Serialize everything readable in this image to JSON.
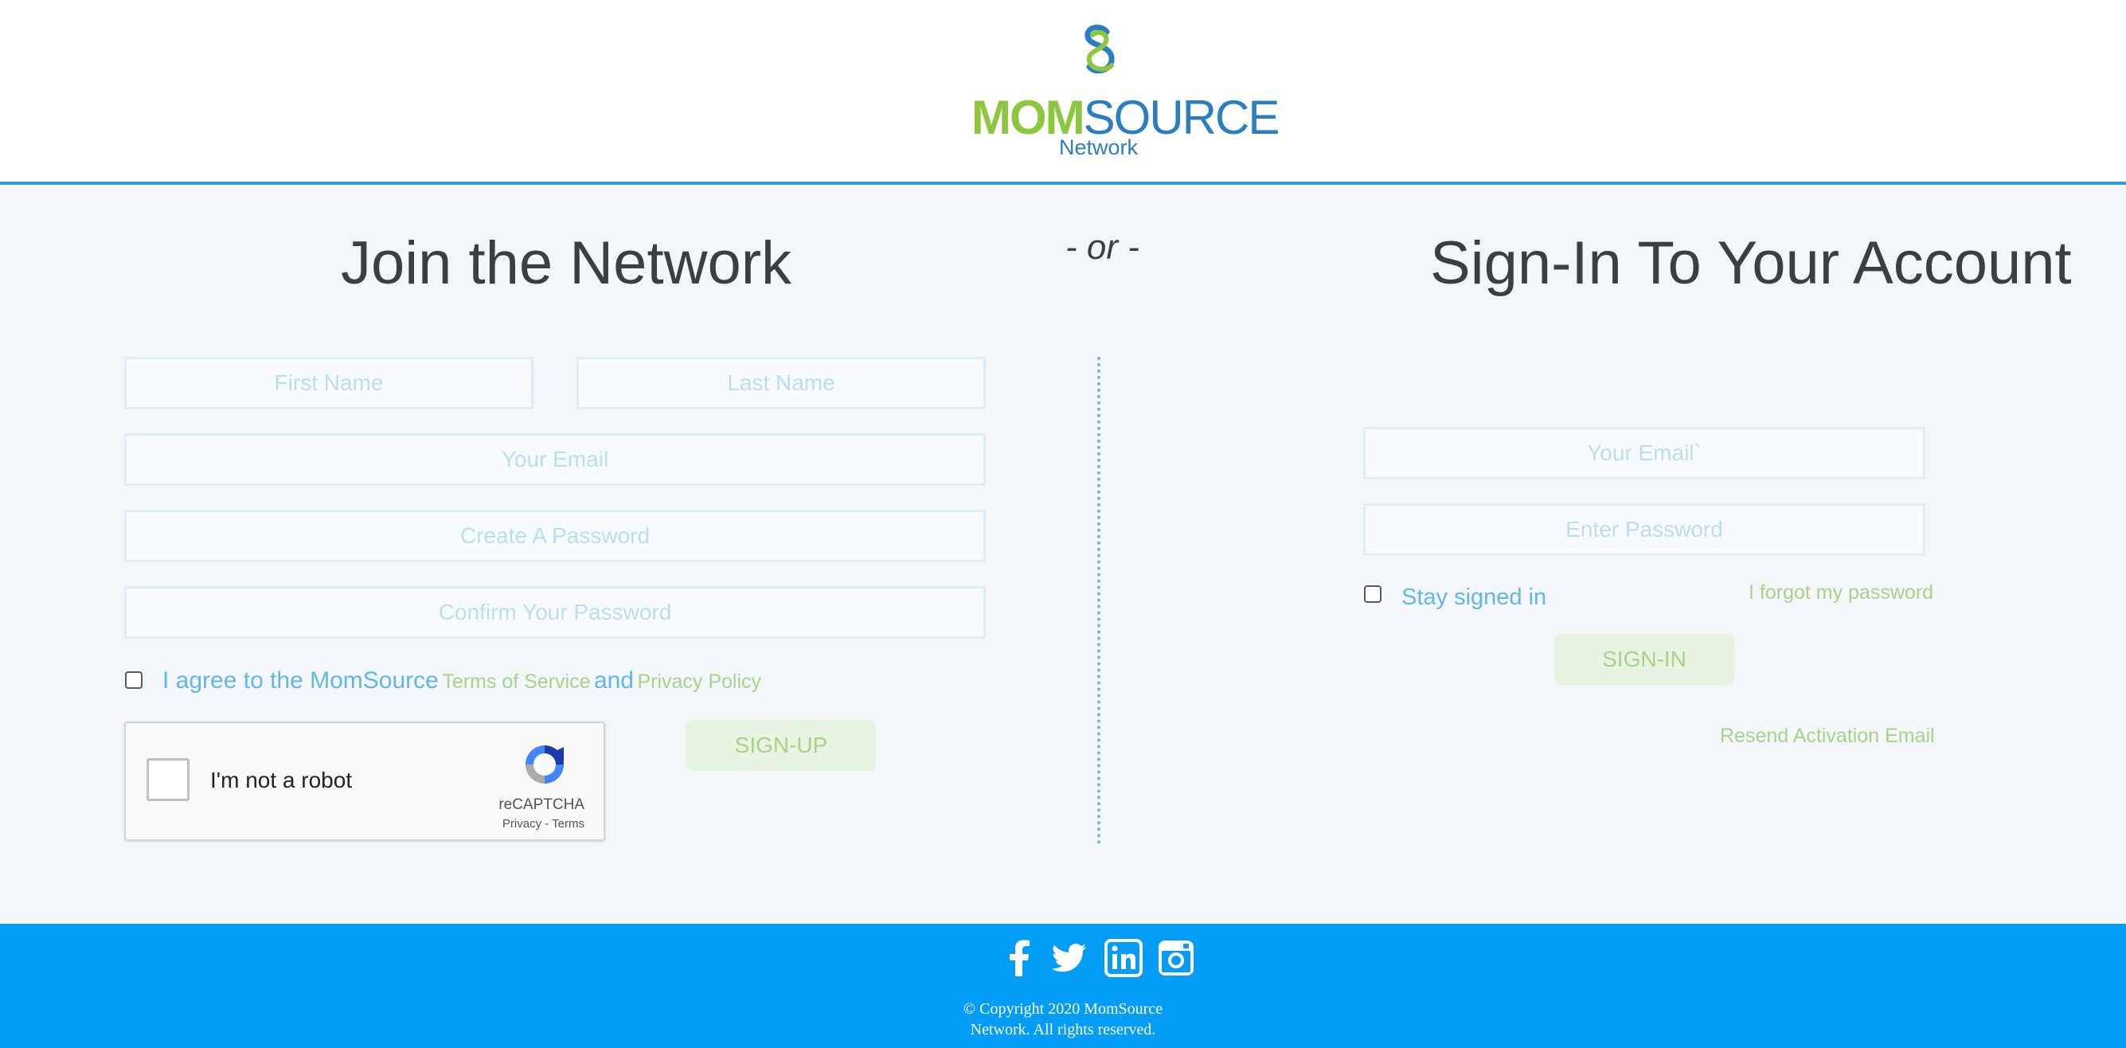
{
  "header": {
    "logo_primary": "MOM",
    "logo_secondary": "SOURCE",
    "logo_subtitle": "Network"
  },
  "signup": {
    "title": "Join the Network",
    "first_name_placeholder": "First Name",
    "last_name_placeholder": "Last Name",
    "email_placeholder": "Your Email",
    "password_placeholder": "Create A Password",
    "confirm_password_placeholder": "Confirm Your Password",
    "agree_prefix": "I agree to the MomSource",
    "terms_link": "Terms of Service",
    "agree_and": "and",
    "privacy_link": "Privacy Policy",
    "signup_button": "SIGN-UP"
  },
  "separator": {
    "or_text": "- or -"
  },
  "recaptcha": {
    "label": "I'm not a robot",
    "brand": "reCAPTCHA",
    "privacy": "Privacy",
    "separator": " - ",
    "terms": "Terms"
  },
  "signin": {
    "title": "Sign-In To Your Account",
    "email_placeholder": "Your Email`",
    "password_placeholder": "Enter Password",
    "stay_signed_in": "Stay signed in",
    "forgot_password": "I forgot my password",
    "signin_button": "SIGN-IN",
    "resend_activation": "Resend Activation Email"
  },
  "footer": {
    "copyright_line1": "© Copyright 2020 MomSource",
    "copyright_line2": "Network. All rights reserved.",
    "social_icons": [
      "facebook-icon",
      "twitter-icon",
      "linkedin-icon",
      "instagram-icon"
    ]
  },
  "colors": {
    "footer_bg": "#039cf7",
    "header_border": "#2b9be0",
    "brand_green": "#8dc63f",
    "brand_blue": "#2a7fc1",
    "link_blue": "#63b6e8",
    "link_green": "#a8d28a"
  }
}
